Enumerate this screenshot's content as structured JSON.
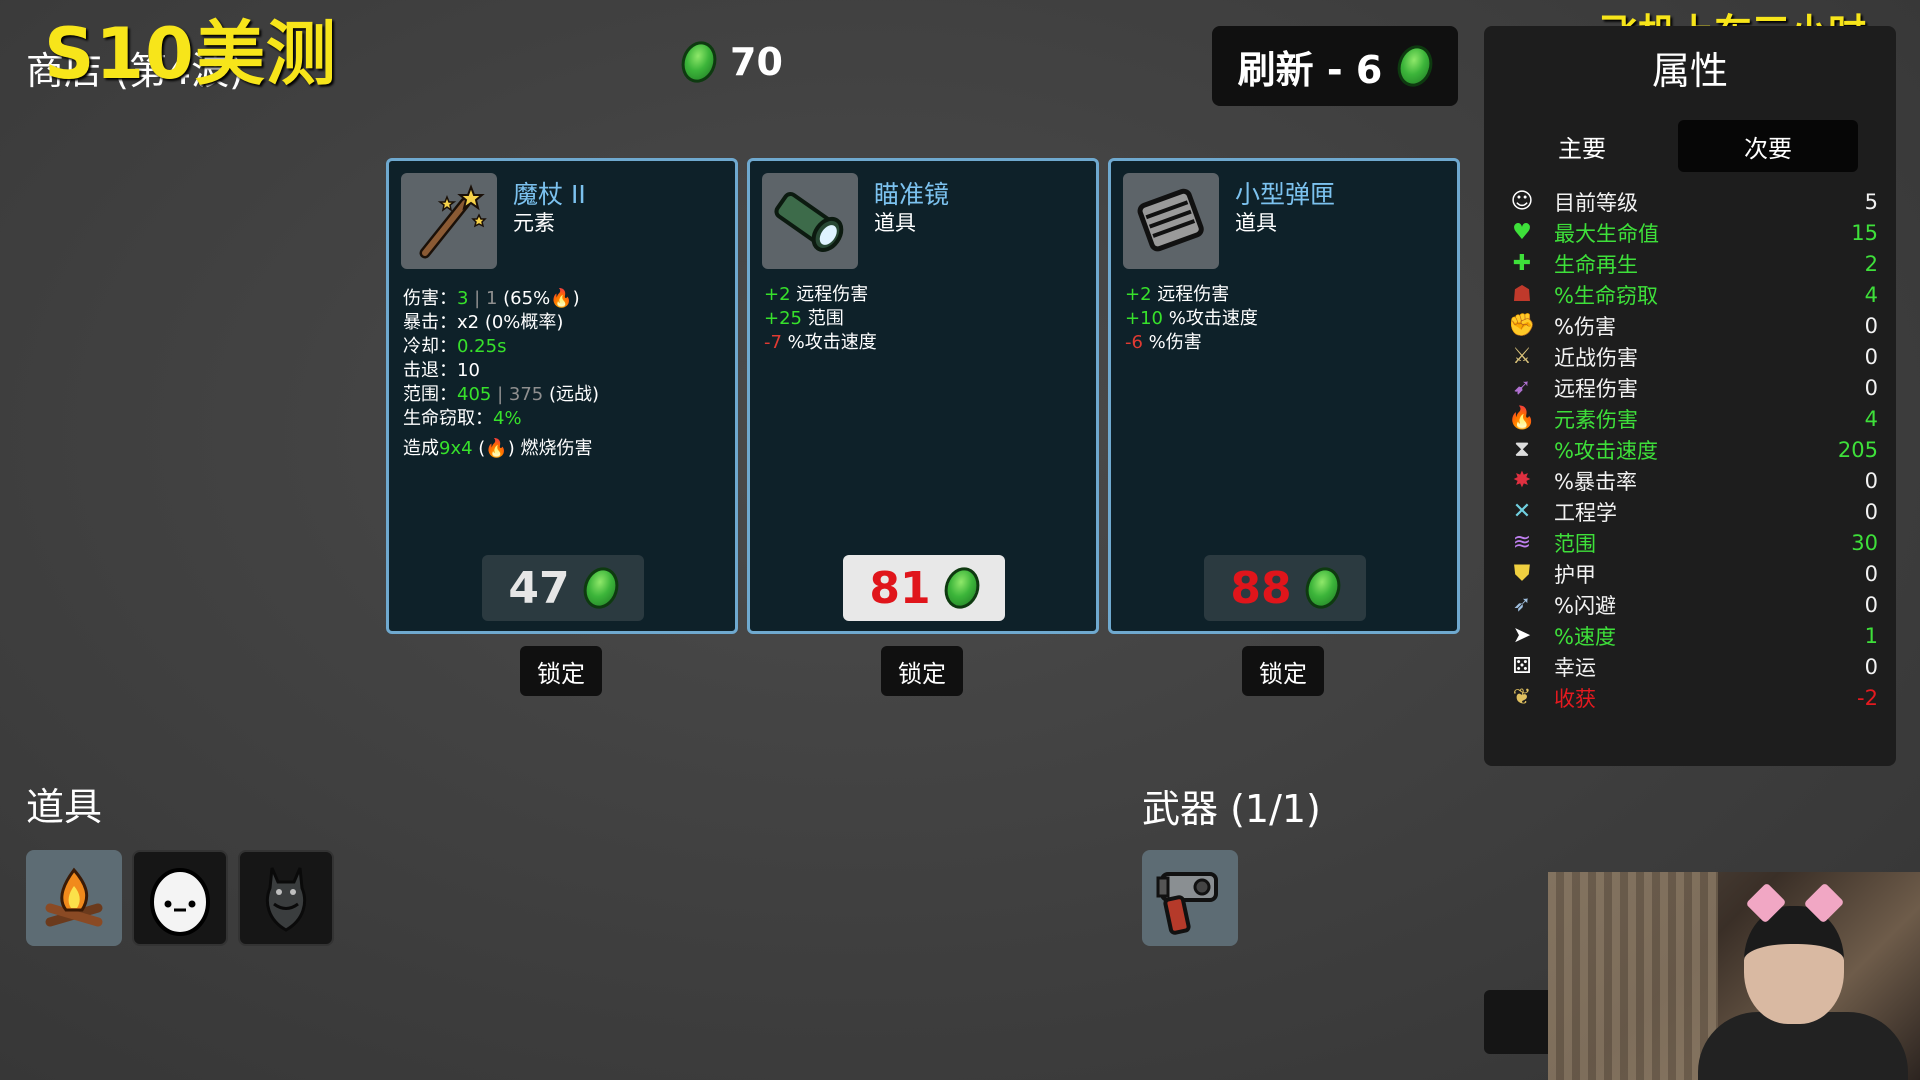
{
  "overlay": {
    "left_caption": "S10美测",
    "right_caption": "飞机上车三小时"
  },
  "header": {
    "shop_title": "商店 (第4波)",
    "coins": "70",
    "refresh_label": "刷新 - 6"
  },
  "cards": [
    {
      "name": "魔杖 II",
      "type": "元素",
      "icon": "magic-wand-icon",
      "stats": {
        "damage_label": "伤害：",
        "damage_val": "3",
        "damage_base": "1",
        "damage_scale": "(65%",
        "damage_scale_end": ")",
        "crit_label": "暴击：x2 (0%概率)",
        "cooldown_label": "冷却：",
        "cooldown_val": "0.25s",
        "knockback_label": "击退：10",
        "range_label": "范围：",
        "range_val": "405",
        "range_base": "375",
        "range_kind": "(远战)",
        "lifesteal_label": "生命窃取：",
        "lifesteal_val": "4%",
        "burn_prefix": "造成",
        "burn_val": "9x4",
        "burn_mid": "(",
        "burn_suffix": ") 燃烧伤害"
      },
      "price": "47",
      "price_color": "#e6e6e6",
      "lock_label": "锁定"
    },
    {
      "name": "瞄准镜",
      "type": "道具",
      "icon": "scope-icon",
      "effects": [
        {
          "val": "+2",
          "text": " 远程伤害",
          "color": "green"
        },
        {
          "val": "+25",
          "text": " 范围",
          "color": "green"
        },
        {
          "val": "-7",
          "text": " %攻击速度",
          "color": "red"
        }
      ],
      "price": "81",
      "price_color": "#e0151b",
      "lock_label": "锁定"
    },
    {
      "name": "小型弹匣",
      "type": "道具",
      "icon": "magazine-icon",
      "effects": [
        {
          "val": "+2",
          "text": " 远程伤害",
          "color": "green"
        },
        {
          "val": "+10",
          "text": " %攻击速度",
          "color": "green"
        },
        {
          "val": "-6",
          "text": " %伤害",
          "color": "red"
        }
      ],
      "price": "88",
      "price_color": "#e0151b",
      "lock_label": "锁定"
    }
  ],
  "items_section": {
    "title": "道具",
    "items": [
      "campfire-icon",
      "egg-icon",
      "bat-icon"
    ]
  },
  "weapons_section": {
    "title": "武器 (1/1)",
    "items": [
      "weapon-gun-icon"
    ]
  },
  "attributes": {
    "title": "属性",
    "tab_primary": "主要",
    "tab_secondary": "次要",
    "rows": [
      {
        "icon": "level-icon",
        "label": "目前等级",
        "value": "5",
        "color": "white"
      },
      {
        "icon": "heart-icon",
        "label": "最大生命值",
        "value": "15",
        "color": "green"
      },
      {
        "icon": "regen-icon",
        "label": "生命再生",
        "value": "2",
        "color": "green"
      },
      {
        "icon": "lifesteal-icon",
        "label": "%生命窃取",
        "value": "4",
        "color": "green"
      },
      {
        "icon": "damage-icon",
        "label": "%伤害",
        "value": "0",
        "color": "white"
      },
      {
        "icon": "melee-icon",
        "label": "近战伤害",
        "value": "0",
        "color": "white"
      },
      {
        "icon": "ranged-icon",
        "label": "远程伤害",
        "value": "0",
        "color": "white"
      },
      {
        "icon": "elemental-icon",
        "label": "元素伤害",
        "value": "4",
        "color": "green"
      },
      {
        "icon": "attack-speed-icon",
        "label": "%攻击速度",
        "value": "205",
        "color": "green"
      },
      {
        "icon": "crit-icon",
        "label": "%暴击率",
        "value": "0",
        "color": "white"
      },
      {
        "icon": "engineering-icon",
        "label": "工程学",
        "value": "0",
        "color": "white"
      },
      {
        "icon": "range-icon",
        "label": "范围",
        "value": "30",
        "color": "green"
      },
      {
        "icon": "armor-icon",
        "label": "护甲",
        "value": "0",
        "color": "white"
      },
      {
        "icon": "dodge-icon",
        "label": "%闪避",
        "value": "0",
        "color": "white"
      },
      {
        "icon": "speed-icon",
        "label": "%速度",
        "value": "1",
        "color": "green"
      },
      {
        "icon": "luck-icon",
        "label": "幸运",
        "value": "0",
        "color": "white"
      },
      {
        "icon": "harvest-icon",
        "label": "收获",
        "value": "-2",
        "color": "red"
      }
    ]
  }
}
